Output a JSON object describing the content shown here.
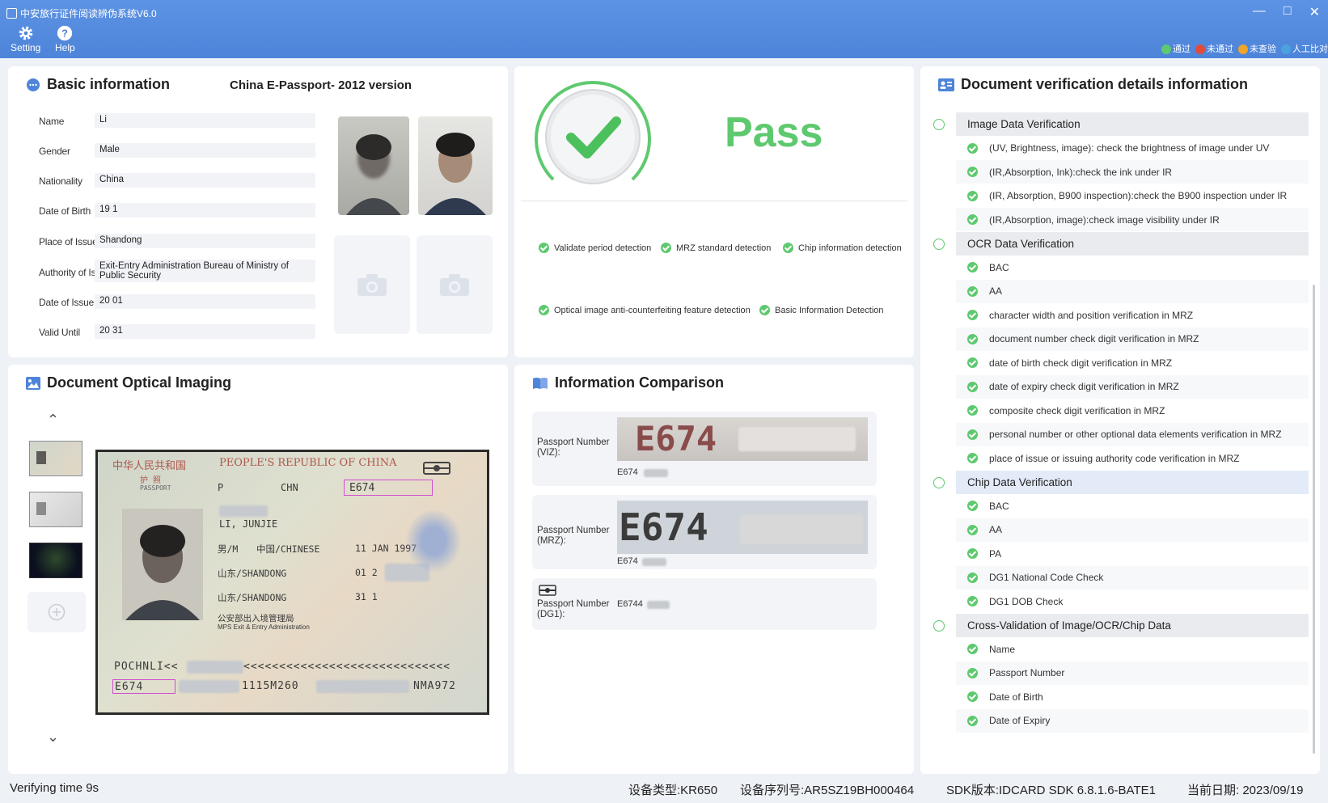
{
  "app": {
    "title": "中安旅行证件阅读辨伪系统V6.0"
  },
  "toolbar": {
    "setting": "Setting",
    "help": "Help"
  },
  "legend": {
    "pass": "通过",
    "fail": "未通过",
    "unchecked": "未查验",
    "manual": "人工比对"
  },
  "basic": {
    "title": "Basic information",
    "doc_type": "China E-Passport- 2012 version",
    "fields": [
      {
        "label": "Name",
        "value": "Li"
      },
      {
        "label": "Gender",
        "value": "Male"
      },
      {
        "label": "Nationality",
        "value": "China"
      },
      {
        "label": "Date of Birth",
        "value": "19        1"
      },
      {
        "label": "Place of Issue",
        "value": "Shandong"
      },
      {
        "label": "Authority of Issue",
        "value": "Exit-Entry Administration Bureau of Ministry of Public Security"
      },
      {
        "label": "Date of Issue",
        "value": "20          01"
      },
      {
        "label": "Valid Until",
        "value": "20          31"
      }
    ]
  },
  "result": {
    "status": "Pass",
    "criteria": [
      "Validate period detection",
      "MRZ standard detection",
      "Chip information detection",
      "Optical image anti-counterfeiting feature detection",
      "Basic Information Detection"
    ]
  },
  "verification": {
    "title": "Document verification details information",
    "sections": [
      {
        "name": "Image Data Verification",
        "items": [
          "(UV, Brightness, image): check the brightness of image under UV",
          "(IR,Absorption, Ink):check the ink under IR",
          "(IR, Absorption, B900 inspection):check the B900 inspection under IR",
          "(IR,Absorption, image):check image visibility under IR"
        ]
      },
      {
        "name": "OCR Data Verification",
        "items": [
          "BAC",
          "AA",
          "character width and position verification in MRZ",
          "document number check digit verification in MRZ",
          "date of birth check digit verification in MRZ",
          "date of expiry check digit verification in MRZ",
          "composite check digit verification in MRZ",
          "personal number or other optional data elements verification in MRZ",
          "place of issue or issuing authority code verification in MRZ"
        ]
      },
      {
        "name": "Chip Data Verification",
        "items": [
          "BAC",
          "AA",
          "PA",
          "DG1 National Code Check",
          "DG1 DOB Check"
        ]
      },
      {
        "name": "Cross-Validation of Image/OCR/Chip Data",
        "items": [
          "Name",
          "Passport Number",
          "Date of Birth",
          "Date of Expiry"
        ]
      }
    ]
  },
  "imaging": {
    "title": "Document Optical Imaging",
    "passport": {
      "header_cn": "中华人民共和国",
      "header_en": "PEOPLE'S REPUBLIC OF CHINA",
      "label_cn": "护  照",
      "label_en": "PASSPORT",
      "type": "P",
      "country": "CHN",
      "number": "E674",
      "name": "LI, JUNJIE",
      "sex": "男/M",
      "nationality": "中国/CHINESE",
      "dob": "11 JAN 1997",
      "birth_place": "山东/SHANDONG",
      "issue_place": "山东/SHANDONG",
      "issue_date": "01 2",
      "expiry_date": "31 1",
      "authority_cn": "公安部出入境管理局",
      "authority_en": "MPS Exit & Entry Administration",
      "mrz1": "POCHNLI<<",
      "mrz1_tail": "<<<<<<<<<<<<<<<<<<<<<<<<<<<<<",
      "mrz2a": "E674",
      "mrz2b": "1115M260",
      "mrz2c": "NMA972"
    }
  },
  "comparison": {
    "title": "Information Comparison",
    "rows": [
      {
        "label": "Passport Number (VIZ):",
        "image_text": "E674",
        "value": "E674"
      },
      {
        "label": "Passport Number (MRZ):",
        "image_text": "E674",
        "value": "E674"
      },
      {
        "label": "Passport Number (DG1):",
        "value": "E6744"
      }
    ]
  },
  "status_bar": {
    "verify_time": "Verifying time 9s",
    "device_type": "设备类型:KR650",
    "serial": "设备序列号:AR5SZ19BH000464",
    "sdk": "SDK版本:IDCARD SDK 6.8.1.6-BATE1",
    "date": "当前日期: 2023/09/19"
  },
  "colors": {
    "accent": "#4e84d9",
    "pass": "#5ec96e",
    "fail": "#e14b3b",
    "unchecked": "#f0a429",
    "manual": "#4aa3df"
  }
}
